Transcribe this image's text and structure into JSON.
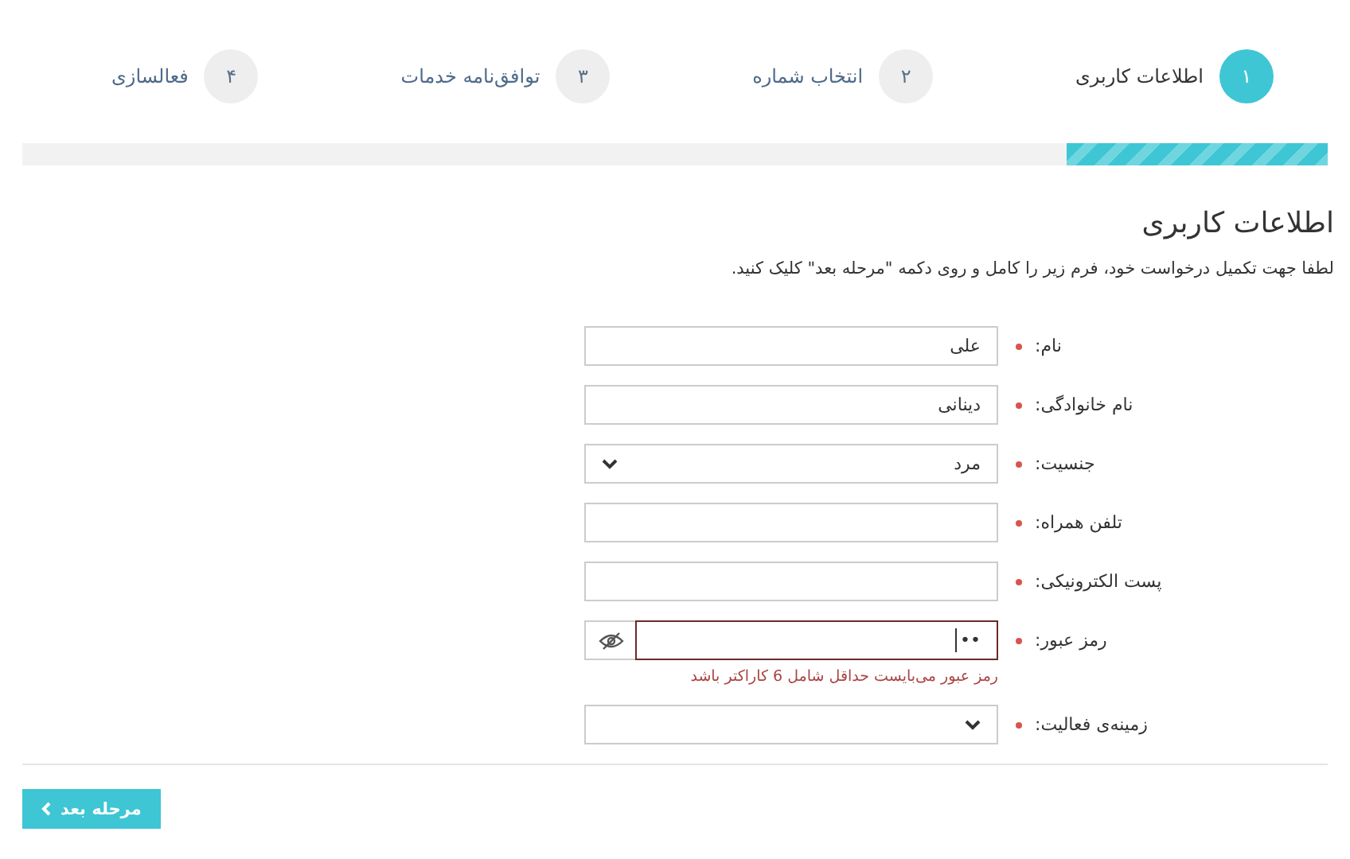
{
  "steps": [
    {
      "number": "۱",
      "label": "اطلاعات کاربری",
      "selected": true
    },
    {
      "number": "۲",
      "label": "انتخاب شماره",
      "selected": false
    },
    {
      "number": "۳",
      "label": "توافق‌نامه خدمات",
      "selected": false
    },
    {
      "number": "۴",
      "label": "فعالسازی",
      "selected": false
    }
  ],
  "progress": {
    "level": 0.2
  },
  "heading": "اطلاعات کاربری",
  "intro": "لطفا جهت تکمیل درخواست خود، فرم زیر را کامل و روی دکمه \"مرحله بعد\" کلیک کنید.",
  "fields": [
    {
      "kind": "text",
      "label": "نام:",
      "required": true,
      "value": "علی"
    },
    {
      "kind": "text",
      "label": "نام خانوادگی:",
      "required": true,
      "value": "دینانی"
    },
    {
      "kind": "select",
      "label": "جنسیت:",
      "required": true,
      "value": "مرد"
    },
    {
      "kind": "text",
      "label": "تلفن همراه:",
      "required": true
    },
    {
      "kind": "text",
      "label": "پست الکترونیکی:",
      "required": true
    },
    {
      "kind": "password",
      "label": "رمز عبور:",
      "required": true,
      "value": "••",
      "error": "رمز عبور می‌بایست حداقل شامل 6 کاراکتر باشد"
    },
    {
      "kind": "select",
      "label": "زمینه‌ی فعالیت:",
      "required": true
    }
  ],
  "next_button": "مرحله بعد"
}
